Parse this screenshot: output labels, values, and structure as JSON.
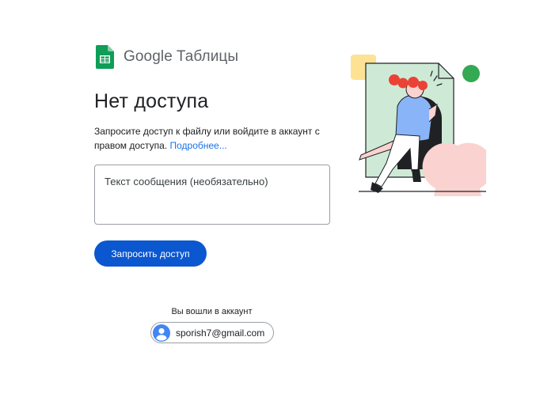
{
  "logo": {
    "icon": "google-sheets-icon",
    "brand": "Google",
    "product": "Таблицы"
  },
  "title": "Нет доступа",
  "description": {
    "text": "Запросите доступ к файлу или войдите в аккаунт с правом доступа.",
    "link": "Подробнее..."
  },
  "message": {
    "placeholder": "Текст сообщения (необязательно)",
    "value": ""
  },
  "request_button": "Запросить доступ",
  "account": {
    "label": "Вы вошли в аккаунт",
    "email": "sporish7@gmail.com",
    "avatar_icon": "account-circle-icon"
  },
  "colors": {
    "primary_button": "#0b57d0",
    "link": "#1a73e8",
    "sheets_green": "#0f9d58",
    "illustration_green": "#34a853",
    "illustration_mint": "#ceead6",
    "illustration_yellow": "#fde293",
    "illustration_pink": "#fad2cf",
    "illustration_red": "#ea4335"
  }
}
